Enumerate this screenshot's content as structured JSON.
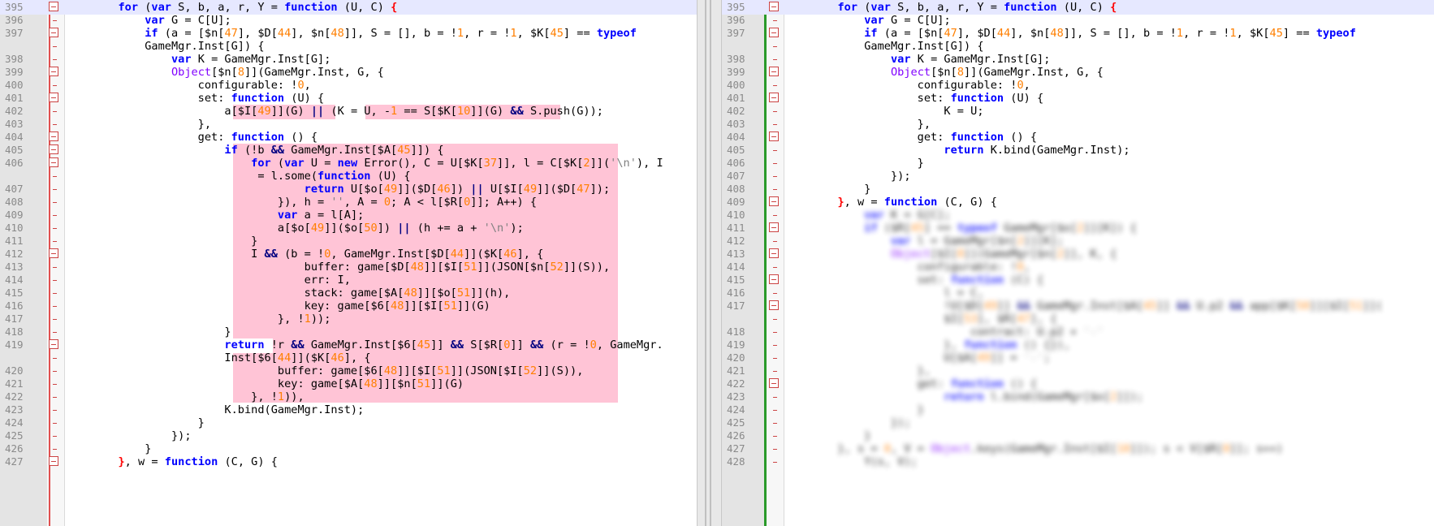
{
  "left": {
    "lines": [
      {
        "n": "395",
        "fold": true,
        "cur": true,
        "html": "        <span class='kw'>for</span> (<span class='kw'>var</span> S, b, a, r, Y = <span class='kw'>function</span> (U, C) <span class='br'>{</span>"
      },
      {
        "n": "396",
        "fold": false,
        "html": "            <span class='kw'>var</span> G = C[U];"
      },
      {
        "n": "397",
        "fold": true,
        "html": "            <span class='kw'>if</span> (a = [$n[<span class='num'>47</span>], $D[<span class='num'>44</span>], $n[<span class='num'>48</span>]], S = [], b = !<span class='num'>1</span>, r = !<span class='num'>1</span>, $K[<span class='num'>45</span>] == <span class='kw'>typeof</span>"
      },
      {
        "n": "",
        "fold": false,
        "html": "            GameMgr.Inst[G]) {"
      },
      {
        "n": "398",
        "fold": false,
        "html": "                <span class='kw'>var</span> K = GameMgr.Inst[G];"
      },
      {
        "n": "399",
        "fold": true,
        "html": "                <span class='fn'>Object</span>[$n[<span class='num'>8</span>]](GameMgr.Inst, G, {"
      },
      {
        "n": "400",
        "fold": false,
        "html": "                    configurable: !<span class='num'>0</span>,"
      },
      {
        "n": "401",
        "fold": true,
        "html": "                    set: <span class='kw'>function</span> (U) {"
      },
      {
        "n": "402",
        "fold": false,
        "html": "                        a[$I[<span class='num'>49</span>]](G) <span class='op'>||</span> (K = U, -<span class='num'>1</span> == S[$K[<span class='num'>10</span>]](G) <span class='op'>&amp;&amp;</span> S.push(G));"
      },
      {
        "n": "403",
        "fold": false,
        "html": "                    },"
      },
      {
        "n": "404",
        "fold": true,
        "html": "                    get: <span class='kw'>function</span> () {"
      },
      {
        "n": "405",
        "fold": true,
        "html": "                        <span class='kw'>if</span> (!b <span class='op'>&amp;&amp;</span> GameMgr.Inst[$A[<span class='num'>45</span>]]) {"
      },
      {
        "n": "406",
        "fold": true,
        "html": "                            <span class='kw'>for</span> (<span class='kw'>var</span> U = <span class='kw'>new</span> Error(), C = U[$K[<span class='num'>37</span>]], l = C[$K[<span class='num'>2</span>]](<span class='str'>'\\n'</span>), I"
      },
      {
        "n": "",
        "fold": false,
        "html": "                             = l.some(<span class='kw'>function</span> (U) {"
      },
      {
        "n": "407",
        "fold": false,
        "html": "                                    <span class='kw'>return</span> U[$o[<span class='num'>49</span>]]($D[<span class='num'>46</span>]) <span class='op'>||</span> U[$I[<span class='num'>49</span>]]($D[<span class='num'>47</span>]);"
      },
      {
        "n": "408",
        "fold": false,
        "html": "                                }), h = <span class='str'>''</span>, A = <span class='num'>0</span>; A &lt; l[$R[<span class='num'>0</span>]]; A++) {"
      },
      {
        "n": "409",
        "fold": false,
        "html": "                                <span class='kw'>var</span> a = l[A];"
      },
      {
        "n": "410",
        "fold": false,
        "html": "                                a[$o[<span class='num'>49</span>]]($o[<span class='num'>50</span>]) <span class='op'>||</span> (h += a + <span class='str'>'\\n'</span>);"
      },
      {
        "n": "411",
        "fold": false,
        "html": "                            }"
      },
      {
        "n": "412",
        "fold": true,
        "html": "                            I <span class='op'>&amp;&amp;</span> (b = !<span class='num'>0</span>, GameMgr.Inst[$D[<span class='num'>44</span>]]($K[<span class='num'>46</span>], {"
      },
      {
        "n": "413",
        "fold": false,
        "html": "                                    buffer: game[$D[<span class='num'>48</span>]][$I[<span class='num'>51</span>]](JSON[$n[<span class='num'>52</span>]](S)),"
      },
      {
        "n": "414",
        "fold": false,
        "html": "                                    err: I,"
      },
      {
        "n": "415",
        "fold": false,
        "html": "                                    stack: game[$A[<span class='num'>48</span>]][$o[<span class='num'>51</span>]](h),"
      },
      {
        "n": "416",
        "fold": false,
        "html": "                                    key: game[$6[<span class='num'>48</span>]][$I[<span class='num'>51</span>]](G)"
      },
      {
        "n": "417",
        "fold": false,
        "html": "                                }, !<span class='num'>1</span>));"
      },
      {
        "n": "418",
        "fold": false,
        "html": "                        }"
      },
      {
        "n": "419",
        "fold": true,
        "html": "                        <span class='kw'>return</span> !r <span class='op'>&amp;&amp;</span> GameMgr.Inst[$6[<span class='num'>45</span>]] <span class='op'>&amp;&amp;</span> S[$R[<span class='num'>0</span>]] <span class='op'>&amp;&amp;</span> (r = !<span class='num'>0</span>, GameMgr."
      },
      {
        "n": "",
        "fold": false,
        "html": "                        Inst[$6[<span class='num'>44</span>]]($K[<span class='num'>46</span>], {"
      },
      {
        "n": "420",
        "fold": false,
        "html": "                                buffer: game[$6[<span class='num'>48</span>]][$I[<span class='num'>51</span>]](JSON[$I[<span class='num'>52</span>]](S)),"
      },
      {
        "n": "421",
        "fold": false,
        "html": "                                key: game[$A[<span class='num'>48</span>]][$n[<span class='num'>51</span>]](G)"
      },
      {
        "n": "422",
        "fold": false,
        "html": "                            }, !<span class='num'>1</span>)),"
      },
      {
        "n": "423",
        "fold": false,
        "html": "                        K.bind(GameMgr.Inst);"
      },
      {
        "n": "424",
        "fold": false,
        "html": "                    }"
      },
      {
        "n": "425",
        "fold": false,
        "html": "                });"
      },
      {
        "n": "426",
        "fold": false,
        "html": "            }"
      },
      {
        "n": "427",
        "fold": true,
        "html": "        <span class='br'>}</span>, w = <span class='kw'>function</span> (C, G) {"
      }
    ]
  },
  "right": {
    "lines": [
      {
        "n": "395",
        "fold": true,
        "cur": true,
        "html": "        <span class='kw'>for</span> (<span class='kw'>var</span> S, b, a, r, Y = <span class='kw'>function</span> (U, C) <span class='br'>{</span>"
      },
      {
        "n": "396",
        "fold": false,
        "html": "            <span class='kw'>var</span> G = C[U];"
      },
      {
        "n": "397",
        "fold": true,
        "html": "            <span class='kw'>if</span> (a = [$n[<span class='num'>47</span>], $D[<span class='num'>44</span>], $n[<span class='num'>48</span>]], S = [], b = !<span class='num'>1</span>, r = !<span class='num'>1</span>, $K[<span class='num'>45</span>] == <span class='kw'>typeof</span>"
      },
      {
        "n": "",
        "fold": false,
        "html": "            GameMgr.Inst[G]) {"
      },
      {
        "n": "398",
        "fold": false,
        "html": "                <span class='kw'>var</span> K = GameMgr.Inst[G];"
      },
      {
        "n": "399",
        "fold": true,
        "html": "                <span class='fn'>Object</span>[$n[<span class='num'>8</span>]](GameMgr.Inst, G, {"
      },
      {
        "n": "400",
        "fold": false,
        "html": "                    configurable: !<span class='num'>0</span>,"
      },
      {
        "n": "401",
        "fold": true,
        "html": "                    set: <span class='kw'>function</span> (U) {"
      },
      {
        "n": "402",
        "fold": false,
        "html": "                        K = U;"
      },
      {
        "n": "403",
        "fold": false,
        "html": "                    },"
      },
      {
        "n": "404",
        "fold": true,
        "html": "                    get: <span class='kw'>function</span> () {"
      },
      {
        "n": "405",
        "fold": false,
        "html": "                        <span class='kw'>return</span> K.bind(GameMgr.Inst);"
      },
      {
        "n": "406",
        "fold": false,
        "html": "                    }"
      },
      {
        "n": "407",
        "fold": false,
        "html": "                });"
      },
      {
        "n": "408",
        "fold": false,
        "html": "            }"
      },
      {
        "n": "409",
        "fold": true,
        "html": "        <span class='br'>}</span>, w = <span class='kw'>function</span> (C, G) {"
      },
      {
        "n": "410",
        "fold": false,
        "blur": true,
        "html": "            <span class='kw'>var</span> K = G[C];"
      },
      {
        "n": "411",
        "fold": true,
        "blur": true,
        "html": "            <span class='kw'>if</span> ($R[<span class='num'>45</span>] == <span class='kw'>typeof</span> GameMgr[$o[<span class='num'>2</span>]][K]) {"
      },
      {
        "n": "412",
        "fold": false,
        "blur": true,
        "html": "                <span class='kw'>var</span> l = GameMgr[$n[<span class='num'>2</span>]][K];"
      },
      {
        "n": "413",
        "fold": true,
        "blur": true,
        "html": "                <span class='fn'>Object</span>[$I[<span class='num'>8</span>]](GameMgr[$n[<span class='num'>2</span>]], K, {"
      },
      {
        "n": "414",
        "fold": false,
        "blur": true,
        "html": "                    configurable: !<span class='num'>0</span>,"
      },
      {
        "n": "415",
        "fold": true,
        "blur": true,
        "html": "                    set: <span class='kw'>function</span> (C) {"
      },
      {
        "n": "416",
        "fold": false,
        "blur": true,
        "html": "                        l = C,"
      },
      {
        "n": "417",
        "fold": true,
        "blur": true,
        "html": "                        !U[$D[<span class='num'>49</span>]] <span class='op'>&amp;&amp;</span> GameMgr.Inst[$A[<span class='num'>45</span>]] <span class='op'>&amp;&amp;</span> U.p2 <span class='op'>&amp;&amp;</span> app[$K[<span class='num'>50</span>]][$I[<span class='num'>51</span>]]("
      },
      {
        "n": "",
        "fold": false,
        "blur": true,
        "html": "                        $I[<span class='num'>53</span>], $R[<span class='num'>47</span>], {"
      },
      {
        "n": "418",
        "fold": false,
        "blur": true,
        "html": "                            contract: U.p2 + <span class='str'>'-'</span>"
      },
      {
        "n": "419",
        "fold": false,
        "blur": true,
        "html": "                        }, <span class='kw'>function</span> () {}),"
      },
      {
        "n": "420",
        "fold": false,
        "blur": true,
        "html": "                        U[$A[<span class='num'>49</span>]] = <span class='str'>'-'</span>;"
      },
      {
        "n": "421",
        "fold": false,
        "blur": true,
        "html": "                    },"
      },
      {
        "n": "422",
        "fold": true,
        "blur": true,
        "html": "                    get: <span class='kw'>function</span> () {"
      },
      {
        "n": "423",
        "fold": false,
        "blur": true,
        "html": "                        <span class='kw'>return</span> l.bind(GameMgr[$o[<span class='num'>2</span>]]);"
      },
      {
        "n": "424",
        "fold": false,
        "blur": true,
        "html": "                    }"
      },
      {
        "n": "425",
        "fold": false,
        "blur": true,
        "html": "                });"
      },
      {
        "n": "426",
        "fold": false,
        "blur": true,
        "html": "            }"
      },
      {
        "n": "427",
        "fold": false,
        "blur": true,
        "html": "        }, s = <span class='num'>0</span>, V = <span class='fn'>Object</span>.keys(GameMgr.Inst[$I[<span class='num'>10</span>]]); s &lt; V[$R[<span class='num'>0</span>]]; s++)"
      },
      {
        "n": "428",
        "fold": false,
        "blur": true,
        "html": "            Y(s, V);"
      }
    ]
  }
}
